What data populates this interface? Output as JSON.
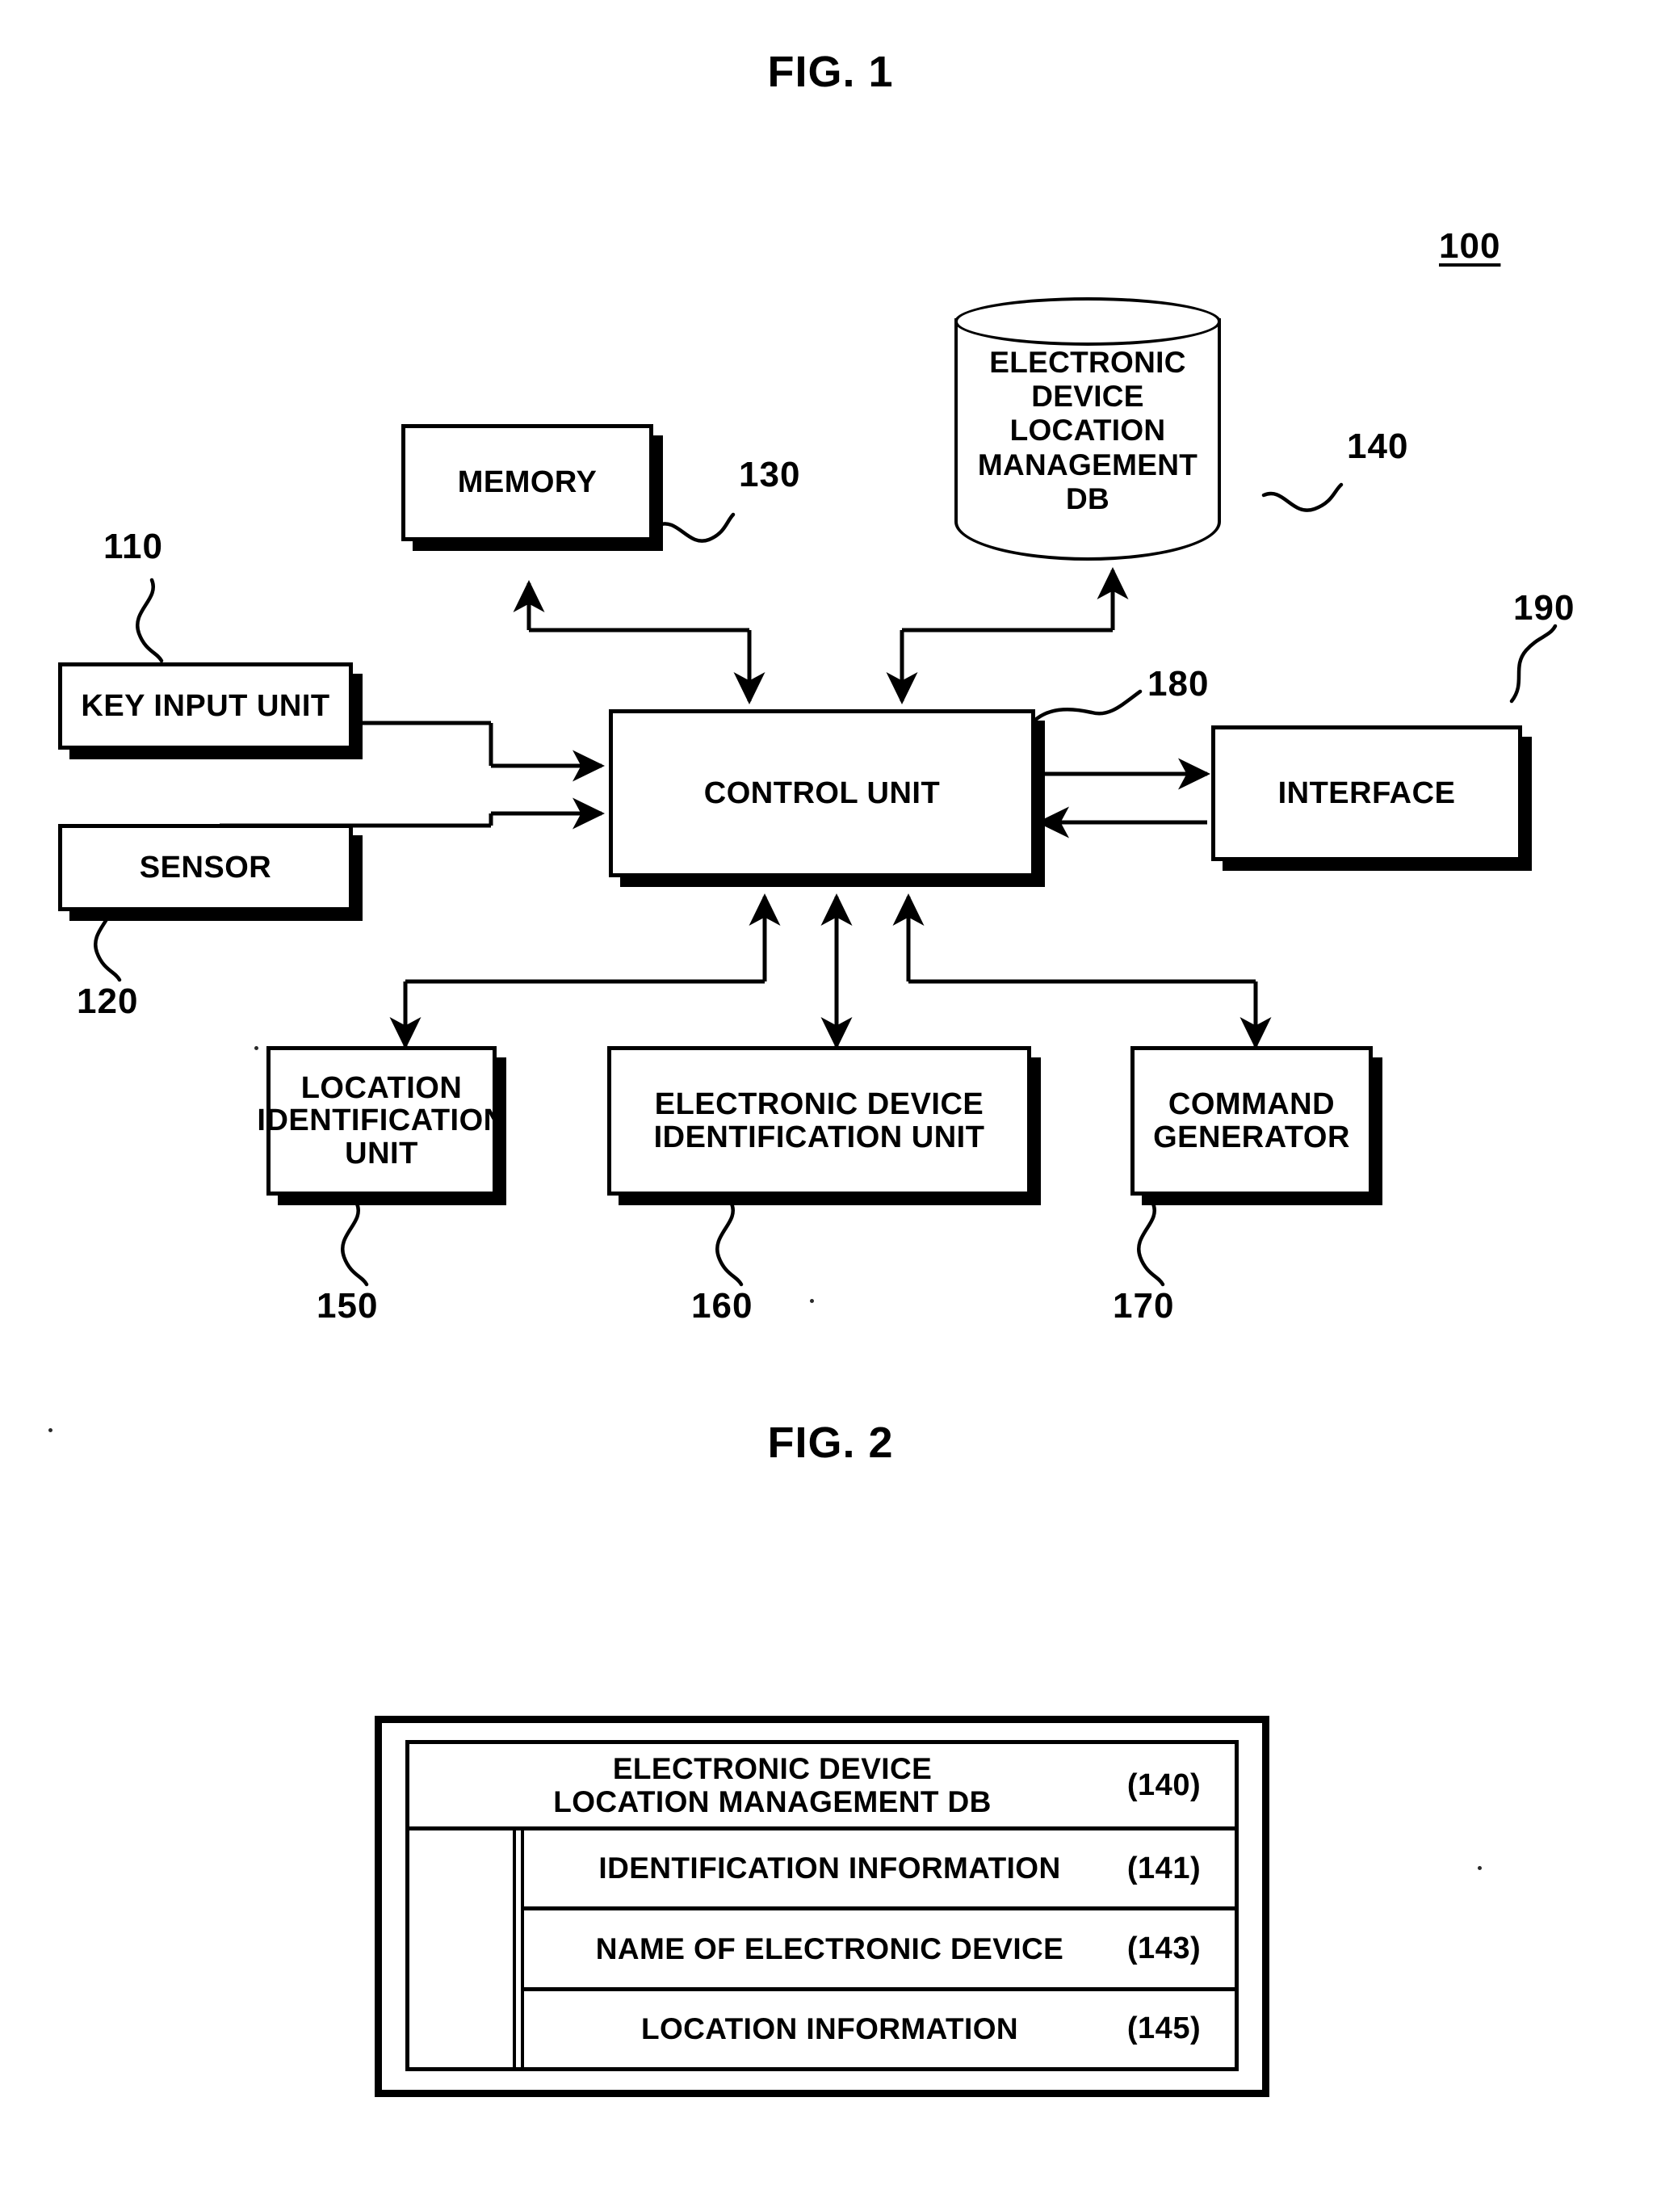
{
  "figures": [
    {
      "id": "fig1",
      "title": "FIG. 1"
    },
    {
      "id": "fig2",
      "title": "FIG. 2"
    }
  ],
  "fig1": {
    "title": "FIG. 1",
    "system_ref": "100",
    "blocks": [
      {
        "key": "memory",
        "label": "MEMORY",
        "ref": "130"
      },
      {
        "key": "db",
        "label": "ELECTRONIC\nDEVICE\nLOCATION\nMANAGEMENT\nDB",
        "ref": "140"
      },
      {
        "key": "key_input",
        "label": "KEY INPUT UNIT",
        "ref": "110"
      },
      {
        "key": "sensor",
        "label": "SENSOR",
        "ref": "120"
      },
      {
        "key": "control",
        "label": "CONTROL UNIT",
        "ref": "180"
      },
      {
        "key": "interface",
        "label": "INTERFACE",
        "ref": "190"
      },
      {
        "key": "location_id",
        "label": "LOCATION\nIDENTIFICATION\nUNIT",
        "ref": "150"
      },
      {
        "key": "device_id",
        "label": "ELECTRONIC DEVICE\nIDENTIFICATION UNIT",
        "ref": "160"
      },
      {
        "key": "command_gen",
        "label": "COMMAND\nGENERATOR",
        "ref": "170"
      }
    ]
  },
  "fig2": {
    "title": "FIG. 2",
    "table": {
      "header": {
        "label": "ELECTRONIC DEVICE\nLOCATION MANAGEMENT DB",
        "ref": "(140)"
      },
      "rows": [
        {
          "label": "IDENTIFICATION INFORMATION",
          "ref": "(141)"
        },
        {
          "label": "NAME OF ELECTRONIC DEVICE",
          "ref": "(143)"
        },
        {
          "label": "LOCATION INFORMATION",
          "ref": "(145)"
        }
      ]
    }
  },
  "colors": {
    "ink": "#000000",
    "paper": "#ffffff"
  }
}
